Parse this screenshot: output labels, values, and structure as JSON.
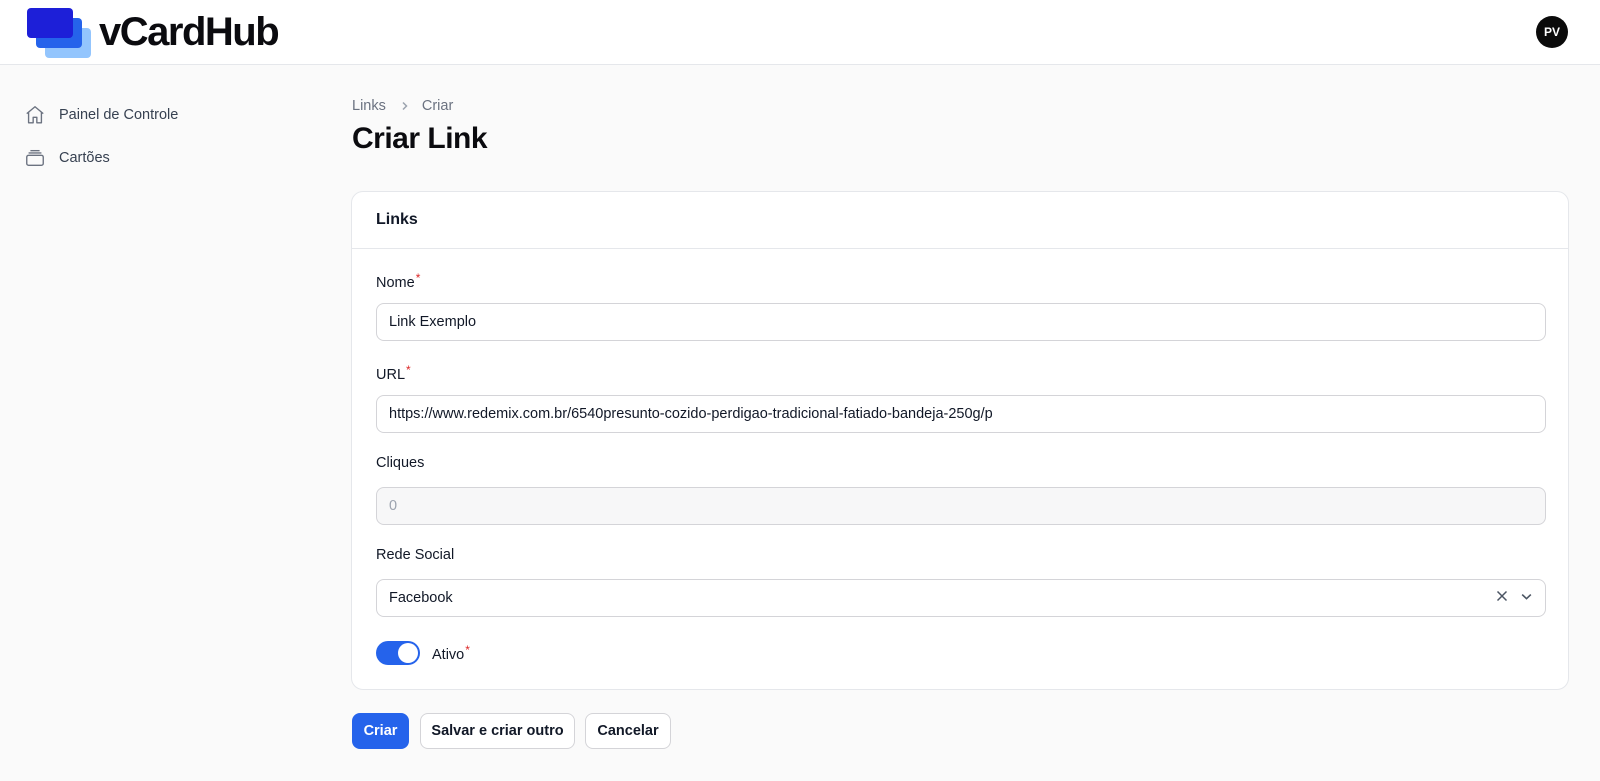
{
  "app": {
    "logo_text": "vCardHub",
    "user_initials": "PV"
  },
  "sidebar": {
    "items": [
      {
        "label": "Painel de Controle",
        "icon": "home-icon"
      },
      {
        "label": "Cartões",
        "icon": "cards-icon"
      }
    ]
  },
  "breadcrumb": {
    "items": [
      "Links",
      "Criar"
    ]
  },
  "page": {
    "title": "Criar Link"
  },
  "form": {
    "section_title": "Links",
    "name": {
      "label": "Nome",
      "required_mark": "*",
      "value": "Link Exemplo"
    },
    "url": {
      "label": "URL",
      "required_mark": "*",
      "value": "https://www.redemix.com.br/6540presunto-cozido-perdigao-tradicional-fatiado-bandeja-250g/p"
    },
    "clicks": {
      "label": "Cliques",
      "value": "0"
    },
    "social": {
      "label": "Rede Social",
      "value": "Facebook"
    },
    "active": {
      "label": "Ativo",
      "required_mark": "*",
      "checked": true
    }
  },
  "actions": {
    "create": "Criar",
    "save_and_create_another": "Salvar e criar outro",
    "cancel": "Cancelar"
  },
  "colors": {
    "primary": "#2563eb",
    "required": "#dc2626"
  }
}
